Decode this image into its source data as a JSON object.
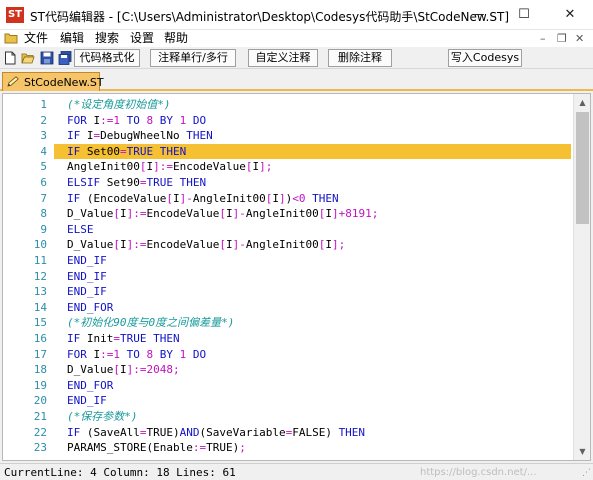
{
  "window": {
    "logo_text": "ST",
    "title": "ST代码编辑器 - [C:\\Users\\Administrator\\Desktop\\Codesys代码助手\\StCodeNew.ST]",
    "minimize": "—",
    "maximize": "☐",
    "close": "✕"
  },
  "menu": {
    "items": [
      "文件",
      "编辑",
      "搜索",
      "设置",
      "帮助"
    ],
    "mdi_minimize": "–",
    "mdi_restore": "❐",
    "mdi_close": "✕"
  },
  "toolbar": {
    "buttons": [
      "代码格式化",
      "注释单行/多行",
      "自定义注释",
      "删除注释",
      "写入Codesys"
    ]
  },
  "tabs": [
    {
      "label": "StCodeNew.ST",
      "active": true
    }
  ],
  "editor": {
    "current_line": 4,
    "lines": [
      {
        "n": "1",
        "tokens": [
          [
            "cm",
            "(*设定角度初始值*)"
          ]
        ]
      },
      {
        "n": "2",
        "tokens": [
          [
            "kw",
            "FOR"
          ],
          [
            "",
            " I"
          ],
          [
            "op",
            ":="
          ],
          [
            "num",
            "1"
          ],
          [
            "",
            " "
          ],
          [
            "kw",
            "TO"
          ],
          [
            "",
            " "
          ],
          [
            "num",
            "8"
          ],
          [
            "",
            " "
          ],
          [
            "kw",
            "BY"
          ],
          [
            "",
            " "
          ],
          [
            "num",
            "1"
          ],
          [
            "",
            " "
          ],
          [
            "kw",
            "DO"
          ]
        ]
      },
      {
        "n": "3",
        "tokens": [
          [
            "kw",
            "IF"
          ],
          [
            "",
            " I"
          ],
          [
            "op",
            "="
          ],
          [
            "",
            "DebugWheelNo "
          ],
          [
            "kw",
            "THEN"
          ]
        ]
      },
      {
        "n": "4",
        "tokens": [
          [
            "kw",
            "IF"
          ],
          [
            "",
            " Set00"
          ],
          [
            "op",
            "="
          ],
          [
            "kw",
            "TRUE"
          ],
          [
            "",
            " "
          ],
          [
            "kw",
            "THEN"
          ]
        ]
      },
      {
        "n": "5",
        "tokens": [
          [
            "",
            "AngleInit00"
          ],
          [
            "op",
            "["
          ],
          [
            "",
            "I"
          ],
          [
            "op",
            "]:="
          ],
          [
            "",
            "EncodeValue"
          ],
          [
            "op",
            "["
          ],
          [
            "",
            "I"
          ],
          [
            "op",
            "];"
          ]
        ]
      },
      {
        "n": "6",
        "tokens": [
          [
            "kw",
            "ELSIF"
          ],
          [
            "",
            " Set90"
          ],
          [
            "op",
            "="
          ],
          [
            "kw",
            "TRUE"
          ],
          [
            "",
            " "
          ],
          [
            "kw",
            "THEN"
          ]
        ]
      },
      {
        "n": "7",
        "tokens": [
          [
            "kw",
            "IF"
          ],
          [
            "",
            " (EncodeValue"
          ],
          [
            "op",
            "["
          ],
          [
            "",
            "I"
          ],
          [
            "op",
            "]-"
          ],
          [
            "",
            "AngleInit00"
          ],
          [
            "op",
            "["
          ],
          [
            "",
            "I"
          ],
          [
            "op",
            "]"
          ],
          [
            "",
            ")"
          ],
          [
            "op",
            "<"
          ],
          [
            "num",
            "0"
          ],
          [
            "",
            " "
          ],
          [
            "kw",
            "THEN"
          ]
        ]
      },
      {
        "n": "8",
        "tokens": [
          [
            "",
            "D_Value"
          ],
          [
            "op",
            "["
          ],
          [
            "",
            "I"
          ],
          [
            "op",
            "]:="
          ],
          [
            "",
            "EncodeValue"
          ],
          [
            "op",
            "["
          ],
          [
            "",
            "I"
          ],
          [
            "op",
            "]-"
          ],
          [
            "",
            "AngleInit00"
          ],
          [
            "op",
            "["
          ],
          [
            "",
            "I"
          ],
          [
            "op",
            "]+"
          ],
          [
            "num",
            "8191"
          ],
          [
            "op",
            ";"
          ]
        ]
      },
      {
        "n": "9",
        "tokens": [
          [
            "kw",
            "ELSE"
          ]
        ]
      },
      {
        "n": "10",
        "tokens": [
          [
            "",
            "D_Value"
          ],
          [
            "op",
            "["
          ],
          [
            "",
            "I"
          ],
          [
            "op",
            "]:="
          ],
          [
            "",
            "EncodeValue"
          ],
          [
            "op",
            "["
          ],
          [
            "",
            "I"
          ],
          [
            "op",
            "]-"
          ],
          [
            "",
            "AngleInit00"
          ],
          [
            "op",
            "["
          ],
          [
            "",
            "I"
          ],
          [
            "op",
            "];"
          ]
        ]
      },
      {
        "n": "11",
        "tokens": [
          [
            "kw",
            "END_IF"
          ]
        ]
      },
      {
        "n": "12",
        "tokens": [
          [
            "kw",
            "END_IF"
          ]
        ]
      },
      {
        "n": "13",
        "tokens": [
          [
            "kw",
            "END_IF"
          ]
        ]
      },
      {
        "n": "14",
        "tokens": [
          [
            "kw",
            "END_FOR"
          ]
        ]
      },
      {
        "n": "15",
        "tokens": [
          [
            "cm",
            "(*初始化90度与0度之间偏差量*)"
          ]
        ]
      },
      {
        "n": "16",
        "tokens": [
          [
            "kw",
            "IF"
          ],
          [
            "",
            " Init"
          ],
          [
            "op",
            "="
          ],
          [
            "kw",
            "TRUE"
          ],
          [
            "",
            " "
          ],
          [
            "kw",
            "THEN"
          ]
        ]
      },
      {
        "n": "17",
        "tokens": [
          [
            "kw",
            "FOR"
          ],
          [
            "",
            " I"
          ],
          [
            "op",
            ":="
          ],
          [
            "num",
            "1"
          ],
          [
            "",
            " "
          ],
          [
            "kw",
            "TO"
          ],
          [
            "",
            " "
          ],
          [
            "num",
            "8"
          ],
          [
            "",
            " "
          ],
          [
            "kw",
            "BY"
          ],
          [
            "",
            " "
          ],
          [
            "num",
            "1"
          ],
          [
            "",
            " "
          ],
          [
            "kw",
            "DO"
          ]
        ]
      },
      {
        "n": "18",
        "tokens": [
          [
            "",
            "D_Value"
          ],
          [
            "op",
            "["
          ],
          [
            "",
            "I"
          ],
          [
            "op",
            "]:="
          ],
          [
            "num",
            "2048"
          ],
          [
            "op",
            ";"
          ]
        ]
      },
      {
        "n": "19",
        "tokens": [
          [
            "kw",
            "END_FOR"
          ]
        ]
      },
      {
        "n": "20",
        "tokens": [
          [
            "kw",
            "END_IF"
          ]
        ]
      },
      {
        "n": "21",
        "tokens": [
          [
            "cm",
            "(*保存参数*)"
          ]
        ]
      },
      {
        "n": "22",
        "tokens": [
          [
            "kw",
            "IF"
          ],
          [
            "",
            " (SaveAll"
          ],
          [
            "op",
            "="
          ],
          [
            "",
            "TRUE)"
          ],
          [
            "kw",
            "AND"
          ],
          [
            "",
            "(SaveVariable"
          ],
          [
            "op",
            "="
          ],
          [
            "",
            "FALSE) "
          ],
          [
            "kw",
            "THEN"
          ]
        ]
      },
      {
        "n": "23",
        "tokens": [
          [
            "",
            "PARAMS_STORE(Enable"
          ],
          [
            "op",
            ":="
          ],
          [
            "",
            "TRUE)"
          ],
          [
            "op",
            ";"
          ]
        ]
      }
    ]
  },
  "status": {
    "text": "CurrentLine: 4 Column: 18 Lines: 61",
    "watermark": "https://blog.csdn.net/..."
  },
  "colors": {
    "keyword": "#1212c8",
    "number": "#c212c2",
    "comment": "#1a9a9a",
    "line_number": "#2b8fa8",
    "current_line_bg": "#f5c031",
    "tab_bg": "#f6c56a"
  }
}
